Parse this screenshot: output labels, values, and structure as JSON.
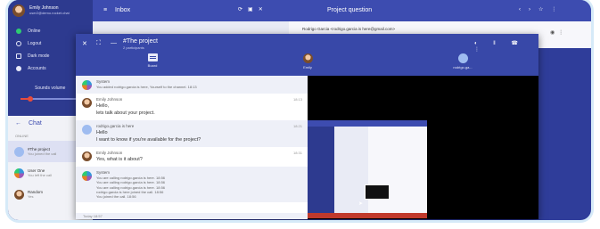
{
  "account": {
    "name": "Emily Johnson",
    "email": "user2@demo.rocket.chat"
  },
  "menu": {
    "online": "Online",
    "logout": "Logout",
    "dark_mode": "Dark mode",
    "accounts": "Accounts",
    "sounds": "Sounds volume"
  },
  "inbox_title": "Inbox",
  "topic_title": "Project question",
  "email_from": "Rodrigo Garcia <rodrigo.garcia is here@gmail.com>",
  "chat": {
    "heading": "Chat",
    "section": "ONLINE",
    "items": [
      {
        "title": "#The project",
        "sub": "You joined the call"
      },
      {
        "title": "User One",
        "sub": "You left the call"
      },
      {
        "title": "Random",
        "sub": "Yes"
      }
    ]
  },
  "call": {
    "title": "#The project",
    "subtitle": "2 participants",
    "participants": [
      {
        "label": "Board"
      },
      {
        "label": "Emily"
      },
      {
        "label": "rodrigo.ga..."
      }
    ]
  },
  "messages": [
    {
      "name": "System",
      "lines": [
        "You added rodrigo.garcia is here, Yourself to the channel. 18:13"
      ],
      "time": "",
      "system": true,
      "avatar": "system"
    },
    {
      "name": "Emily Johnson",
      "lines": [
        "Hello,",
        "lets talk about your project."
      ],
      "time": "18:13",
      "system": false,
      "avatar": "emily"
    },
    {
      "name": "rodrigo.garcia is here",
      "lines": [
        "Hello",
        "I want to know if you're available for the project?"
      ],
      "time": "18:21",
      "system": true,
      "avatar": "rodrigo"
    },
    {
      "name": "Emily Johnson",
      "lines": [
        "Yes, what is it about?"
      ],
      "time": "18:31",
      "system": false,
      "avatar": "emily"
    },
    {
      "name": "System",
      "lines": [
        "You are calling rodrigo.garcia is here. 18:56",
        "You are calling rodrigo.garcia is here. 18:56",
        "You are calling rodrigo.garcia is here. 18:56",
        "rodrigo.garcia is here joined the call. 18:56",
        "You joined the call. 18:56"
      ],
      "time": "",
      "system": true,
      "avatar": "system",
      "small": true
    }
  ],
  "today_label": "Today 18:57"
}
